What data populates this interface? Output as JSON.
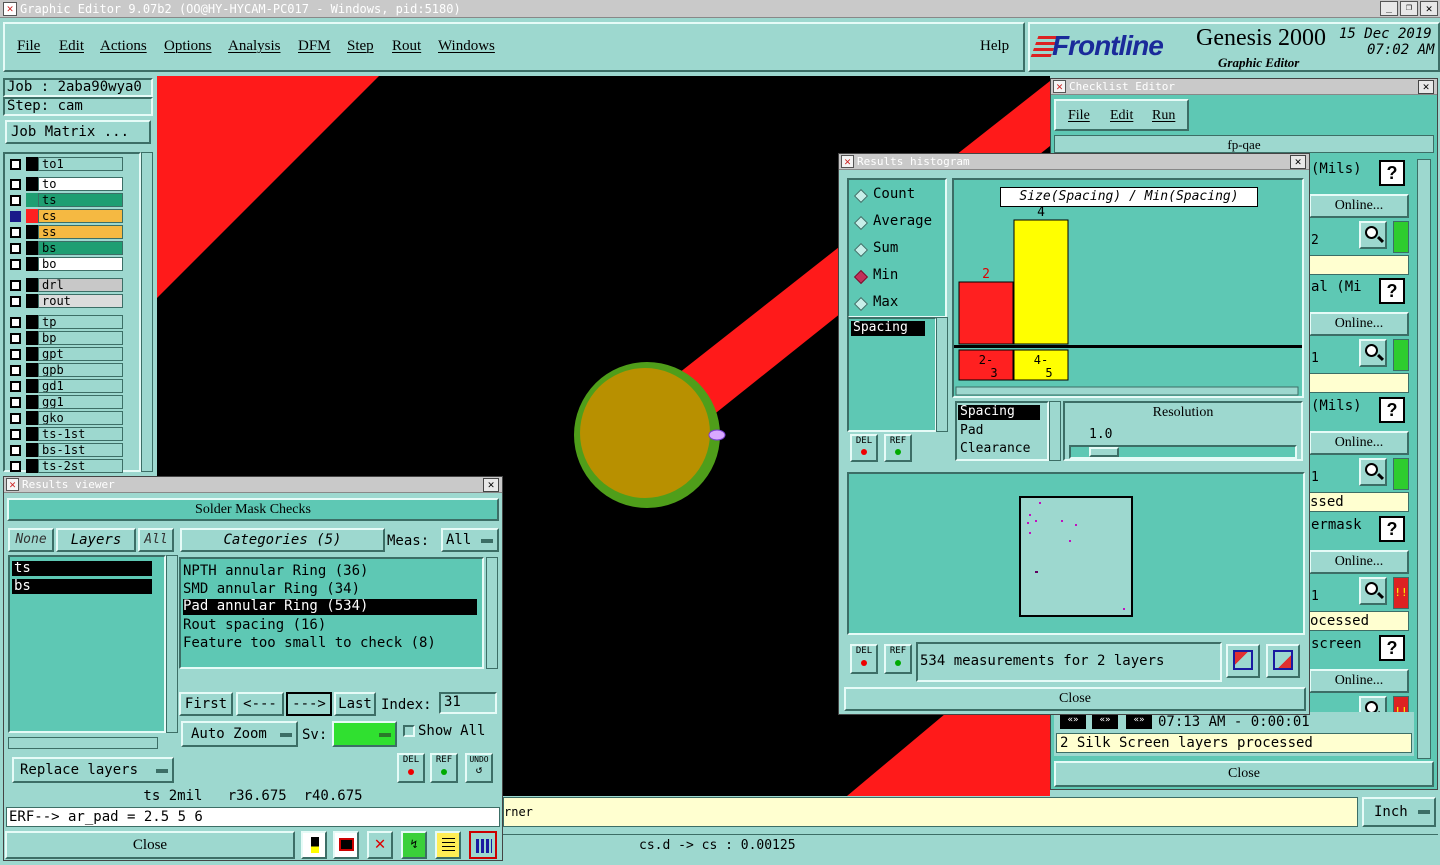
{
  "window": {
    "title": "Graphic Editor 9.07b2 (OO@HY-HYCAM-PC017 - Windows, pid:5180)"
  },
  "menubar": {
    "items": [
      "File",
      "Edit",
      "Actions",
      "Options",
      "Analysis",
      "DFM",
      "Step",
      "Rout",
      "Windows"
    ],
    "help": "Help"
  },
  "brand": {
    "logo": "Frontline",
    "product": "Genesis 2000",
    "subtitle": "Graphic Editor",
    "date": "15 Dec 2019",
    "time": "07:02 AM"
  },
  "job": {
    "job_line": "Job : 2aba90wya0",
    "step_line": "Step: cam",
    "matrix_button": "Job Matrix ..."
  },
  "layers": [
    {
      "name": "to1",
      "bg": "#9dd8cf",
      "swatch": "#000000"
    },
    {
      "name": "to",
      "bg": "#ffffff",
      "swatch": "#000000"
    },
    {
      "name": "ts",
      "bg": "#1e9e72",
      "swatch": "#1e9e72"
    },
    {
      "name": "cs",
      "bg": "#f5b942",
      "swatch": "#ff2020",
      "active": true
    },
    {
      "name": "ss",
      "bg": "#f5b942",
      "swatch": "#000000"
    },
    {
      "name": "bs",
      "bg": "#1e9e72",
      "swatch": "#000000"
    },
    {
      "name": "bo",
      "bg": "#ffffff",
      "swatch": "#000000"
    },
    {
      "name": "drl",
      "bg": "#c8c8c8",
      "swatch": "#000000"
    },
    {
      "name": "rout",
      "bg": "#dcdcdc",
      "swatch": "#000000"
    },
    {
      "name": "tp",
      "bg": "#9dd8cf",
      "swatch": "#000000"
    },
    {
      "name": "bp",
      "bg": "#9dd8cf",
      "swatch": "#000000"
    },
    {
      "name": "gpt",
      "bg": "#9dd8cf",
      "swatch": "#000000"
    },
    {
      "name": "gpb",
      "bg": "#9dd8cf",
      "swatch": "#000000"
    },
    {
      "name": "gd1",
      "bg": "#9dd8cf",
      "swatch": "#000000"
    },
    {
      "name": "gg1",
      "bg": "#9dd8cf",
      "swatch": "#000000"
    },
    {
      "name": "gko",
      "bg": "#9dd8cf",
      "swatch": "#000000"
    },
    {
      "name": "ts-1st",
      "bg": "#9dd8cf",
      "swatch": "#000000"
    },
    {
      "name": "bs-1st",
      "bg": "#9dd8cf",
      "swatch": "#000000"
    },
    {
      "name": "ts-2st",
      "bg": "#9dd8cf",
      "swatch": "#000000"
    }
  ],
  "results_viewer": {
    "title": "Results viewer",
    "header": "Solder Mask Checks",
    "none": "None",
    "layers_label": "Layers",
    "all": "All",
    "categories": "Categories (5)",
    "meas_label": "Meas:",
    "meas_value": "All",
    "layer_list": [
      "ts",
      "bs"
    ],
    "category_list": [
      "NPTH annular Ring (36)",
      "SMD annular Ring (34)",
      "Pad annular Ring (534)",
      "Rout spacing (16)",
      "Feature too small to check (8)"
    ],
    "first": "First",
    "prev": "<---",
    "next": "--->",
    "last": "Last",
    "index_label": "Index:",
    "index_value": "31",
    "auto_zoom": "Auto Zoom",
    "sv_label": "Sv:",
    "show_all": "Show All",
    "replace_layers": "Replace layers",
    "info_line": "ts 2mil   r36.675  r40.675",
    "erf_line": "ERF--> ar_pad = 2.5 5 6",
    "close": "Close",
    "del": "DEL",
    "ref": "REF",
    "undo": "UNDO"
  },
  "histogram": {
    "title": "Results histogram",
    "modes": [
      "Count",
      "Average",
      "Sum",
      "Min",
      "Max"
    ],
    "selected_mode": "Min",
    "left_list": [
      "Spacing"
    ],
    "chart_title": "Size(Spacing) / Min(Spacing)",
    "resolution_label": "Resolution",
    "resolution_value": "1.0",
    "measure_list": [
      "Spacing",
      "Pad",
      "Clearance"
    ],
    "summary": "534 measurements for 2 layers",
    "close": "Close",
    "del": "DEL",
    "ref": "REF"
  },
  "chart_data": {
    "type": "bar",
    "categories": [
      "2-3",
      "4-5"
    ],
    "values": [
      2,
      4
    ],
    "colors": [
      "#ff2020",
      "#ffff00"
    ],
    "title": "Size(Spacing) / Min(Spacing)",
    "ylim": [
      0,
      4
    ]
  },
  "checklist": {
    "title": "Checklist Editor",
    "menu": [
      "File",
      "Edit",
      "Run"
    ],
    "name": "fp-qae",
    "rows": [
      {
        "label": "(Mils)",
        "online": "Online...",
        "num": "2",
        "status": "",
        "ind": "#2ecc2e"
      },
      {
        "label": "al (Mi",
        "online": "Online...",
        "num": "1",
        "status": "",
        "ind": "#2ecc2e"
      },
      {
        "label": "(Mils)",
        "online": "Online...",
        "num": "1",
        "status": "ssed",
        "ind": "#2ecc2e"
      },
      {
        "label": "ermask",
        "online": "Online...",
        "num": "1",
        "status": "ocessed",
        "ind": "#dd2222"
      },
      {
        "label": "screen",
        "online": "Online...",
        "num": "",
        "status": "",
        "ind": "#dd2222"
      }
    ],
    "time_line": "07:13 AM - 0:00:01",
    "status_line": "2 Silk Screen layers processed",
    "close": "Close"
  },
  "bottom": {
    "message": "rner",
    "units": "Inch",
    "coords": "cs.d -> cs : 0.00125"
  }
}
